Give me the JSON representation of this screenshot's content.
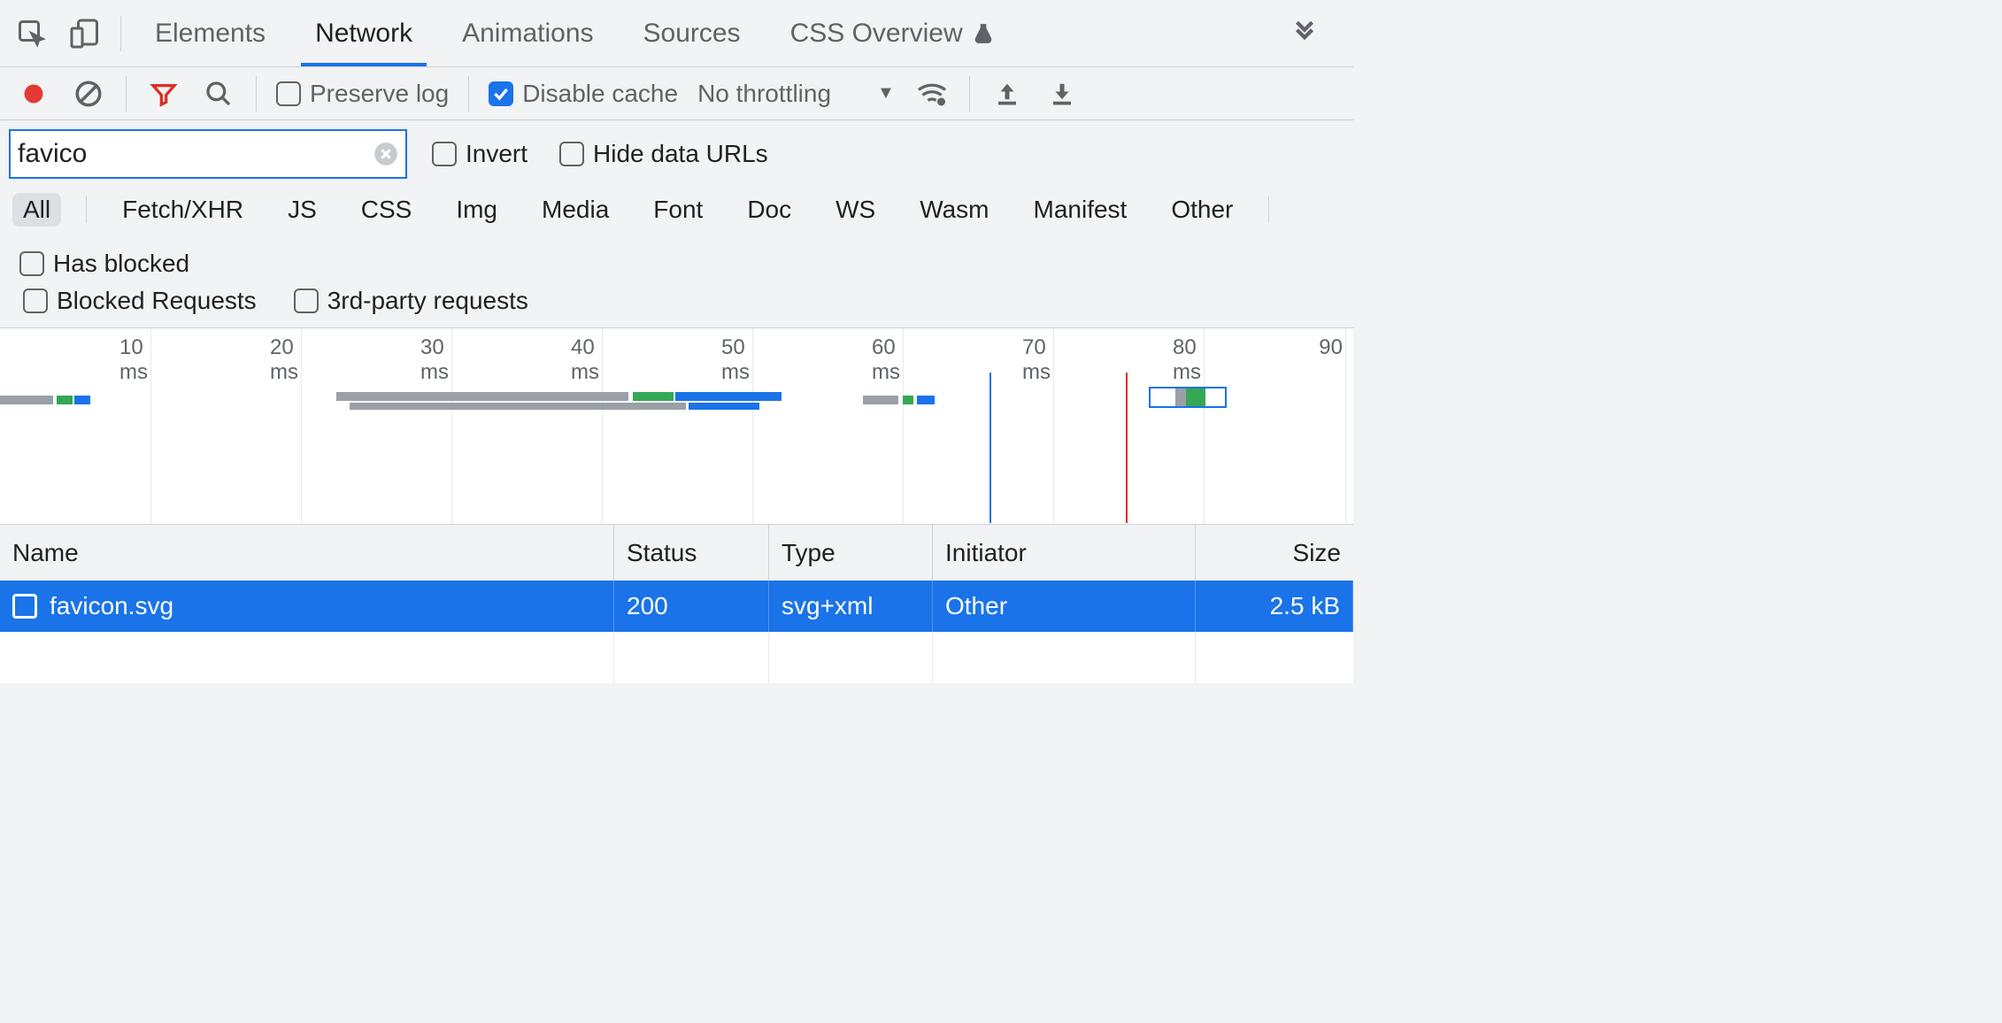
{
  "tabs": [
    "Elements",
    "Network",
    "Animations",
    "Sources",
    "CSS Overview"
  ],
  "active_tab": "Network",
  "toolbar": {
    "preserve_log_label": "Preserve log",
    "preserve_log_checked": false,
    "disable_cache_label": "Disable cache",
    "disable_cache_checked": true,
    "throttling_label": "No throttling"
  },
  "filter": {
    "value": "favico",
    "invert_label": "Invert",
    "invert_checked": false,
    "hide_data_urls_label": "Hide data URLs",
    "hide_data_urls_checked": false
  },
  "type_filters": [
    "All",
    "Fetch/XHR",
    "JS",
    "CSS",
    "Img",
    "Media",
    "Font",
    "Doc",
    "WS",
    "Wasm",
    "Manifest",
    "Other"
  ],
  "type_filter_active": "All",
  "has_blocked_label": "Has blocked",
  "blocked_requests_label": "Blocked Requests",
  "third_party_label": "3rd-party requests",
  "overview_ticks": [
    "10 ms",
    "20 ms",
    "30 ms",
    "40 ms",
    "50 ms",
    "60 ms",
    "70 ms",
    "80 ms",
    "90"
  ],
  "columns": [
    "Name",
    "Status",
    "Type",
    "Initiator",
    "Size"
  ],
  "rows": [
    {
      "name": "favicon.svg",
      "status": "200",
      "type": "svg+xml",
      "initiator": "Other",
      "size": "2.5 kB"
    }
  ]
}
